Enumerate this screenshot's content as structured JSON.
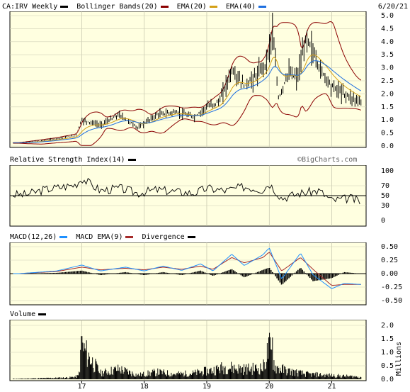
{
  "header": {
    "symbol_label": "CA:IRV Weekly",
    "bollinger_label": "Bollinger Bands(20)",
    "ema20_label": "EMA(20)",
    "ema40_label": "EMA(40)",
    "date": "6/20/21"
  },
  "rsi_panel": {
    "title": "Relative Strength Index(14)",
    "watermark": "©BigCharts.com"
  },
  "macd_panel": {
    "title": "MACD(12,26)",
    "ema_label": "MACD EMA(9)",
    "div_label": "Divergence"
  },
  "volume_panel": {
    "title": "Volume",
    "unit": "Millions"
  },
  "colors": {
    "bg": "#ffffe0",
    "bb": "#8b0000",
    "ema20": "#d4a017",
    "ema40": "#1e6fe0",
    "macd": "#1e90ff",
    "macd_ema": "#a52a2a",
    "black": "#000000"
  },
  "chart_data": [
    {
      "type": "line",
      "title": "CA:IRV Weekly",
      "y_ticks": [
        "5.0",
        "4.5",
        "4.0",
        "3.5",
        "3.0",
        "2.5",
        "2.0",
        "1.5",
        "1.0",
        "0.5",
        "0.0"
      ],
      "ylim": [
        0,
        5.0
      ],
      "x_ticks": [
        "17",
        "18",
        "19",
        "20",
        "21"
      ],
      "x": [
        2016.0,
        2016.5,
        2016.9,
        2017.0,
        2017.3,
        2017.6,
        2017.9,
        2018.2,
        2018.5,
        2018.8,
        2019.0,
        2019.2,
        2019.4,
        2019.6,
        2019.8,
        2019.95,
        2020.05,
        2020.15,
        2020.3,
        2020.45,
        2020.6,
        2020.8,
        2021.0,
        2021.2,
        2021.45
      ],
      "close": [
        0.12,
        0.25,
        0.4,
        1.0,
        0.8,
        1.2,
        0.7,
        1.2,
        1.3,
        1.1,
        1.5,
        1.7,
        2.9,
        2.3,
        2.7,
        3.2,
        4.4,
        1.8,
        2.8,
        2.6,
        4.2,
        3.0,
        2.3,
        2.0,
        1.7
      ],
      "series": [
        {
          "name": "Bollinger Bands(20)",
          "color": "#8b0000"
        },
        {
          "name": "EMA(20)",
          "color": "#d4a017"
        },
        {
          "name": "EMA(40)",
          "color": "#1e6fe0"
        }
      ]
    },
    {
      "type": "line",
      "title": "Relative Strength Index(14)",
      "y_ticks": [
        "100",
        "70",
        "50",
        "30",
        "0"
      ],
      "ylim": [
        0,
        100
      ],
      "x": [
        2016.1,
        2016.4,
        2016.7,
        2016.9,
        2017.0,
        2017.3,
        2017.6,
        2017.9,
        2018.2,
        2018.5,
        2018.8,
        2019.0,
        2019.3,
        2019.6,
        2019.9,
        2020.0,
        2020.2,
        2020.5,
        2020.8,
        2021.0,
        2021.3,
        2021.45
      ],
      "values": [
        52,
        62,
        68,
        72,
        85,
        60,
        65,
        55,
        62,
        58,
        55,
        65,
        60,
        68,
        62,
        75,
        45,
        55,
        60,
        40,
        45,
        38
      ]
    },
    {
      "type": "line",
      "title": "MACD(12,26)",
      "y_ticks": [
        "0.50",
        "0.25",
        "0.00",
        "-0.25",
        "-0.50"
      ],
      "ylim": [
        -0.5,
        0.5
      ],
      "x": [
        2016.0,
        2016.6,
        2017.0,
        2017.3,
        2017.7,
        2018.0,
        2018.3,
        2018.6,
        2018.9,
        2019.1,
        2019.4,
        2019.6,
        2019.9,
        2020.0,
        2020.2,
        2020.5,
        2020.7,
        2021.0,
        2021.2,
        2021.45
      ],
      "series": [
        {
          "name": "MACD(12,26)",
          "values": [
            0.0,
            0.05,
            0.16,
            0.05,
            0.12,
            0.05,
            0.14,
            0.06,
            0.18,
            0.05,
            0.36,
            0.15,
            0.35,
            0.48,
            -0.1,
            0.38,
            -0.02,
            -0.28,
            -0.18,
            -0.2
          ]
        },
        {
          "name": "MACD EMA(9)",
          "values": [
            0.0,
            0.04,
            0.12,
            0.07,
            0.1,
            0.07,
            0.12,
            0.08,
            0.14,
            0.08,
            0.3,
            0.2,
            0.3,
            0.4,
            0.05,
            0.3,
            0.08,
            -0.22,
            -0.2,
            -0.2
          ]
        }
      ]
    },
    {
      "type": "bar",
      "title": "Volume",
      "y_ticks": [
        "2.0",
        "1.5",
        "1.0",
        "0.5",
        "0.0"
      ],
      "ylim": [
        0,
        2.0
      ],
      "ylabel": "Millions",
      "x": [
        2016.0,
        2016.4,
        2016.8,
        2016.95,
        2017.0,
        2017.3,
        2017.6,
        2017.9,
        2018.2,
        2018.5,
        2018.8,
        2019.1,
        2019.3,
        2019.6,
        2019.9,
        2020.0,
        2020.1,
        2020.3,
        2020.6,
        2020.9,
        2021.2,
        2021.45
      ],
      "values": [
        0.02,
        0.05,
        0.08,
        0.15,
        1.6,
        0.3,
        0.5,
        0.2,
        0.35,
        0.25,
        0.3,
        0.45,
        0.6,
        0.5,
        0.55,
        1.55,
        0.6,
        0.4,
        0.25,
        0.2,
        0.15,
        0.12
      ]
    }
  ]
}
